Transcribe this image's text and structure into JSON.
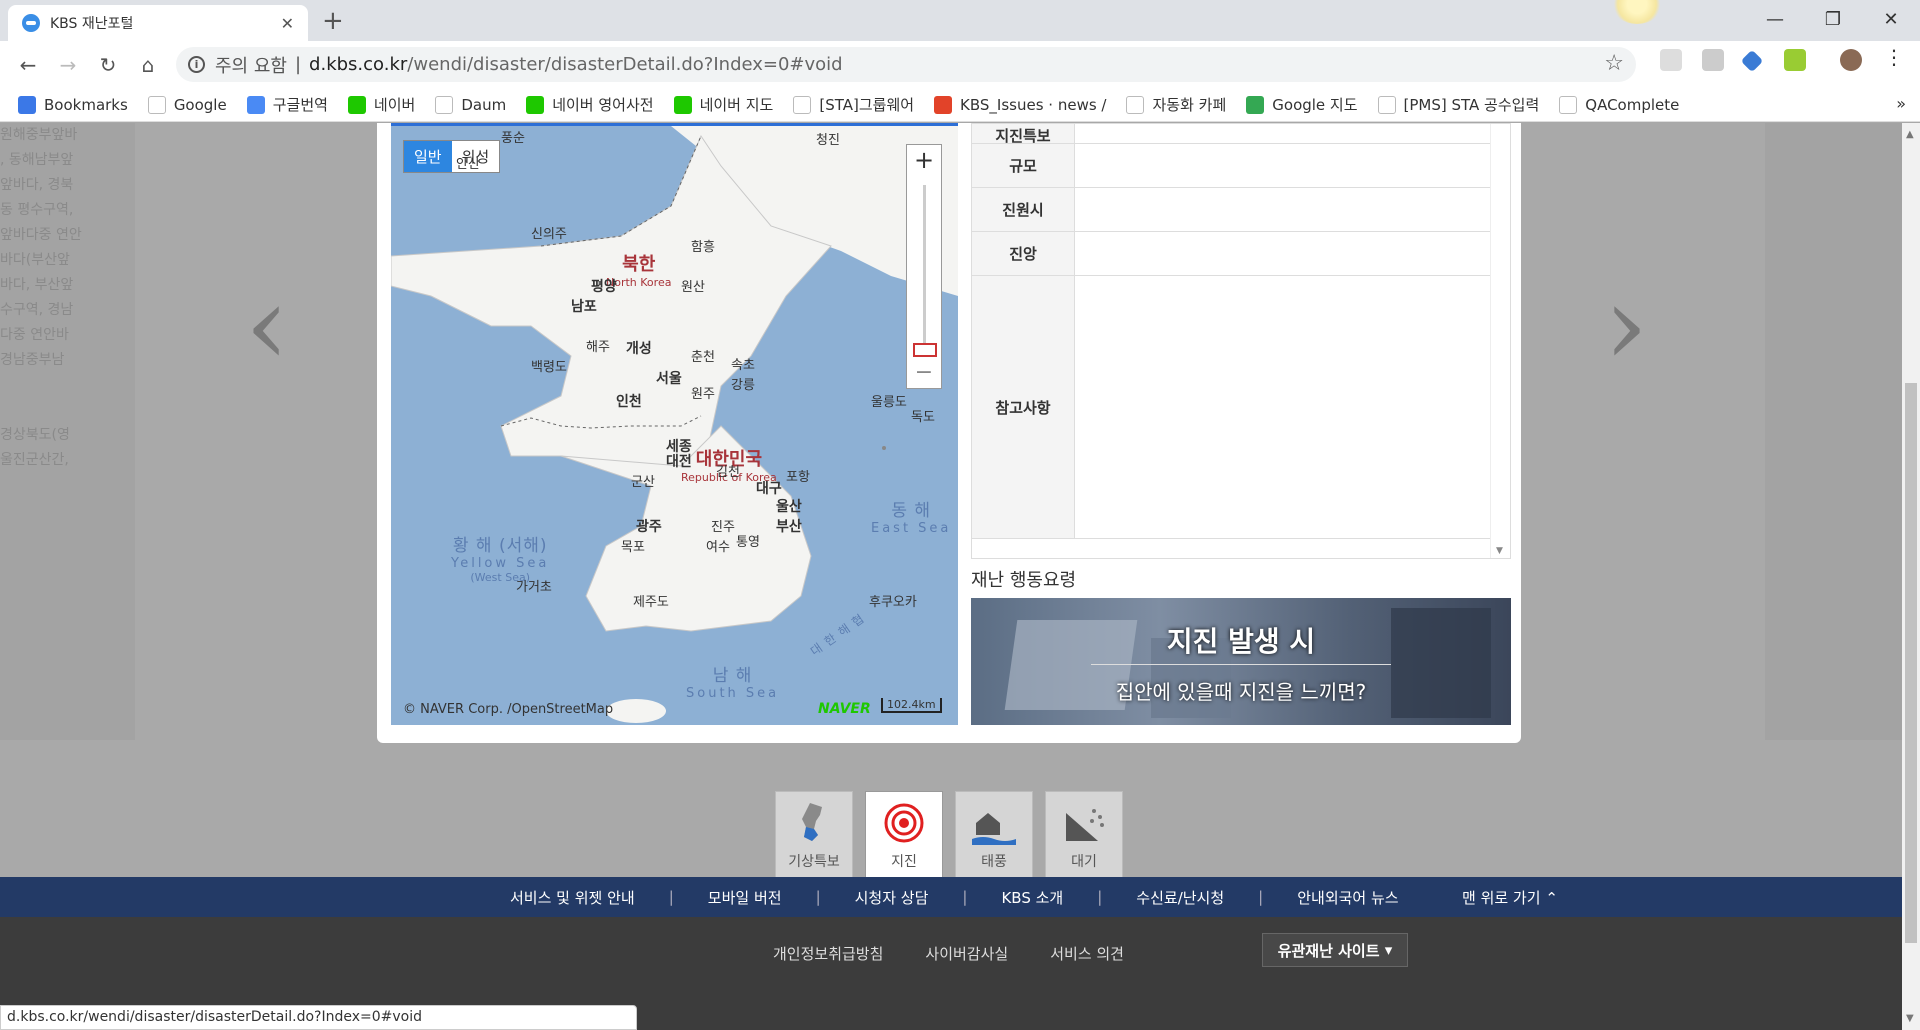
{
  "browser": {
    "tab_title": "KBS 재난포털",
    "tab_close": "✕",
    "new_tab": "+",
    "warning": "주의 요함",
    "url_domain": "d.kbs.co.kr",
    "url_path": "/wendi/disaster/disasterDetail.do?Index=0#void",
    "status_url": "d.kbs.co.kr/wendi/disaster/disasterDetail.do?Index=0#void"
  },
  "bookmarks": [
    {
      "label": "Bookmarks",
      "icon": "star-icon",
      "color": "#3b78e7"
    },
    {
      "label": "Google",
      "icon": "google-icon",
      "color": "#ffffff"
    },
    {
      "label": "구글번역",
      "icon": "translate-icon",
      "color": "#4a8af4"
    },
    {
      "label": "네이버",
      "icon": "naver-icon",
      "color": "#1ec800"
    },
    {
      "label": "Daum",
      "icon": "daum-icon",
      "color": "#ffffff"
    },
    {
      "label": "네이버 영어사전",
      "icon": "dict-icon",
      "color": "#1ec800"
    },
    {
      "label": "네이버 지도",
      "icon": "naver-icon",
      "color": "#1ec800"
    },
    {
      "label": "[STA]그룹웨어",
      "icon": "page-icon",
      "color": "#ffffff"
    },
    {
      "label": "KBS_Issues · news /",
      "icon": "gitlab-icon",
      "color": "#e24329"
    },
    {
      "label": "자동화 카페",
      "icon": "sta-icon",
      "color": "#ffffff"
    },
    {
      "label": "Google 지도",
      "icon": "maps-icon",
      "color": "#34a853"
    },
    {
      "label": "[PMS] STA 공수입력",
      "icon": "pms-icon",
      "color": "#ffffff"
    },
    {
      "label": "QAComplete",
      "icon": "qa-icon",
      "color": "#ffffff"
    }
  ],
  "bookmarks_more": "»",
  "left_card_text": [
    "원해중부앞바",
    ", 동해남부앞",
    "앞바다, 경북",
    "동 평수구역,",
    "앞바다중 연안",
    "바다(부산앞",
    "바다, 부산앞",
    "수구역, 경남",
    "다중 연안바",
    "경남중부남",
    "",
    "",
    "경상북도(영",
    "울진군산간,"
  ],
  "nav_arrows": {
    "prev": "‹",
    "next": "›"
  },
  "map": {
    "btn_normal": "일반",
    "btn_satellite": "위성",
    "zoom_in": "+",
    "zoom_out": "−",
    "copyright": "© NAVER Corp. /OpenStreetMap",
    "naver_logo": "NAVER",
    "scale": "102.4km",
    "north_korea": "북한",
    "north_korea_en": "North Korea",
    "south_korea": "대한민국",
    "south_korea_en": "Republic of Korea",
    "yellow_sea": "황 해 (서해)",
    "yellow_sea_en": "Yellow Sea",
    "yellow_sea_en2": "(West Sea)",
    "east_sea": "동 해",
    "east_sea_en": "East Sea",
    "south_sea": "남 해",
    "south_sea_en": "South Sea",
    "sea_label": "대 한 해 협",
    "cities": [
      "청진",
      "신의주",
      "함흥",
      "평양",
      "원산",
      "남포",
      "해주",
      "개성",
      "속초",
      "춘천",
      "백령도",
      "강릉",
      "서울",
      "원주",
      "인천",
      "울릉도",
      "독도",
      "세종",
      "대전",
      "김천",
      "포항",
      "군산",
      "대구",
      "울산",
      "광주",
      "진주",
      "부산",
      "목포",
      "여수",
      "통영",
      "제주도",
      "가거초",
      "후쿠오카",
      "풍순",
      "안산"
    ]
  },
  "info": {
    "rows": [
      {
        "label": "지진특보"
      },
      {
        "label": "규모"
      },
      {
        "label": "진원시"
      },
      {
        "label": "진앙"
      },
      {
        "label": "참고사항"
      }
    ]
  },
  "guide": {
    "title": "재난 행동요령",
    "banner_title": "지진 발생 시",
    "banner_sub": "집안에 있을때 지진을 느끼면?"
  },
  "disaster_icons": [
    {
      "label": "기상특보"
    },
    {
      "label": "지진"
    },
    {
      "label": "태풍"
    },
    {
      "label": "대기"
    }
  ],
  "footer": {
    "links1": [
      "서비스 및 위젯 안내",
      "모바일 버전",
      "시청자 상담",
      "KBS 소개",
      "수신료/난시청",
      "안내외국어 뉴스"
    ],
    "top": "맨 위로 가기",
    "links2": [
      "개인정보취급방침",
      "사이버감사실",
      "서비스 의견"
    ],
    "related": "유관재난 사이트"
  }
}
